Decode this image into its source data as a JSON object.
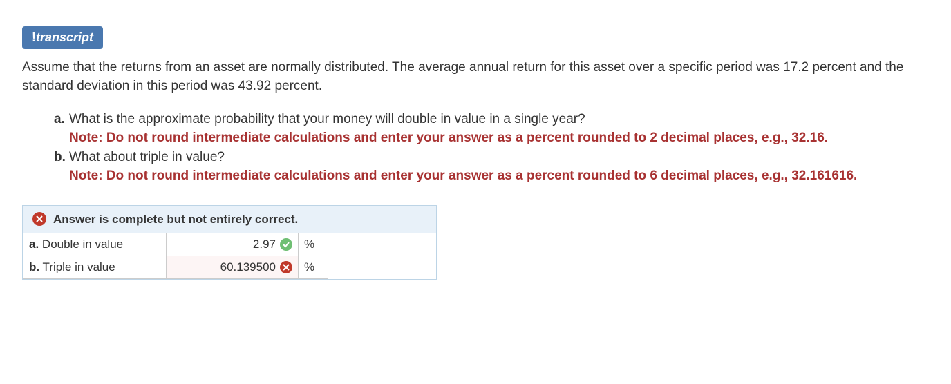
{
  "transcript_button": "transcript",
  "transcript_button_prefix": "!",
  "question_text": "Assume that the returns from an asset are normally distributed. The average annual return for this asset over a specific period was 17.2 percent and the standard deviation in this period was 43.92 percent.",
  "parts": {
    "a": {
      "label": "a.",
      "text": "What is the approximate probability that your money will double in value in a single year?",
      "note": "Note: Do not round intermediate calculations and enter your answer as a percent rounded to 2 decimal places, e.g., 32.16."
    },
    "b": {
      "label": "b.",
      "text": "What about triple in value?",
      "note": "Note: Do not round intermediate calculations and enter your answer as a percent rounded to 6 decimal places, e.g., 32.161616."
    }
  },
  "answer_header": "Answer is complete but not entirely correct.",
  "answers": {
    "a": {
      "label_prefix": "a.",
      "label_text": " Double in value",
      "value": "2.97",
      "unit": "%",
      "status": "correct"
    },
    "b": {
      "label_prefix": "b.",
      "label_text": " Triple in value",
      "value": "60.139500",
      "unit": "%",
      "status": "incorrect"
    }
  }
}
